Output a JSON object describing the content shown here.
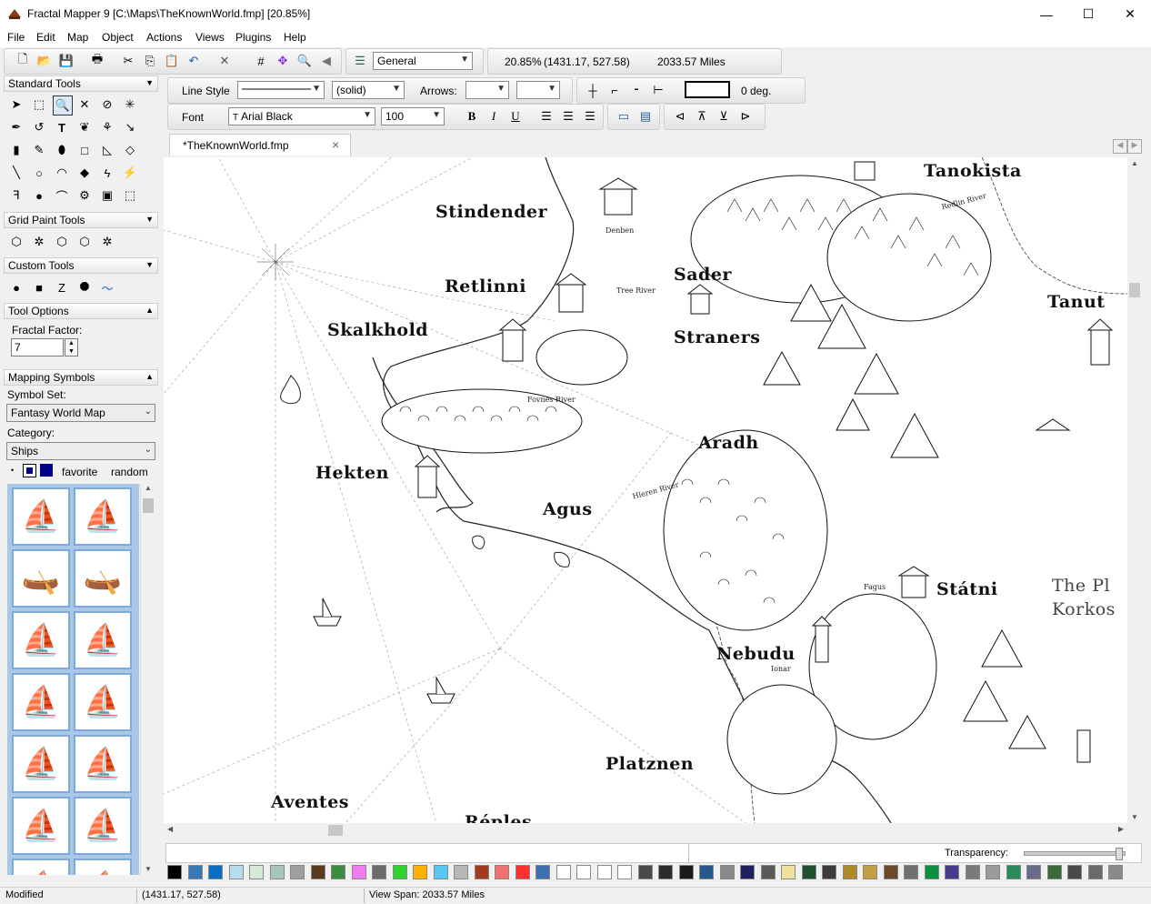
{
  "window": {
    "title": "Fractal Mapper 9 [C:\\Maps\\TheKnownWorld.fmp] [20.85%]",
    "minimize_glyph": "—",
    "maximize_glyph": "☐",
    "close_glyph": "✕"
  },
  "menu": [
    "File",
    "Edit",
    "Map",
    "Object",
    "Actions",
    "Views",
    "Plugins",
    "Help"
  ],
  "main_toolbar": {
    "layer": "General",
    "zoom": "20.85%",
    "coords": "(1431.17, 527.58)",
    "span": "2033.57 Miles"
  },
  "line_toolbar": {
    "line_style_label": "Line Style",
    "line_style_value": "(solid)",
    "arrows_label": "Arrows:",
    "angle": "0 deg."
  },
  "font_toolbar": {
    "font_label": "Font",
    "font_value": "Arial Black",
    "size_value": "100",
    "bold": "B",
    "italic": "I",
    "underline": "U"
  },
  "tab": {
    "label": "*TheKnownWorld.fmp",
    "close": "×"
  },
  "panels": {
    "standard_tools": "Standard Tools",
    "grid_paint_tools": "Grid Paint Tools",
    "custom_tools": "Custom Tools",
    "tool_options": "Tool Options",
    "fractal_factor_label": "Fractal Factor:",
    "fractal_factor_value": "7",
    "mapping_symbols": "Mapping Symbols",
    "symbol_set_label": "Symbol Set:",
    "symbol_set_value": "Fantasy World Map",
    "category_label": "Category:",
    "category_value": "Ships",
    "favorite_label": "favorite",
    "random_label": "random"
  },
  "map_labels": [
    {
      "name": "tanokista",
      "text": "Tanokista"
    },
    {
      "name": "stindender",
      "text": "Stindender"
    },
    {
      "name": "sader",
      "text": "Sader"
    },
    {
      "name": "tanut",
      "text": "Tanut"
    },
    {
      "name": "retlinni",
      "text": "Retlinni"
    },
    {
      "name": "skalkhold",
      "text": "Skalkhold"
    },
    {
      "name": "straners",
      "text": "Straners"
    },
    {
      "name": "aradh",
      "text": "Aradh"
    },
    {
      "name": "hekten",
      "text": "Hekten"
    },
    {
      "name": "agus",
      "text": "Agus"
    },
    {
      "name": "statni",
      "text": "Státni"
    },
    {
      "name": "the-pl",
      "text": "The Pl"
    },
    {
      "name": "korkos",
      "text": "Korkos"
    },
    {
      "name": "nebudu",
      "text": "Nebudu"
    },
    {
      "name": "platznen",
      "text": "Platznen"
    },
    {
      "name": "aventes",
      "text": "Aventes"
    },
    {
      "name": "reples",
      "text": "Réples"
    }
  ],
  "map_small_labels": [
    {
      "name": "denben",
      "text": "Denben"
    },
    {
      "name": "tree-river",
      "text": "Tree River"
    },
    {
      "name": "fovnes-river",
      "text": "Fovnes River"
    },
    {
      "name": "hleren-river",
      "text": "Hleren River"
    },
    {
      "name": "fagus",
      "text": "Fagus"
    },
    {
      "name": "ionar",
      "text": "Ionar"
    },
    {
      "name": "redlin-river",
      "text": "Redlin River"
    }
  ],
  "bottom": {
    "transparency_label": "Transparency:",
    "palette": [
      "#000000",
      "#3a78b5",
      "#0a6fc2",
      "#b7dcf0",
      "#d6ead7",
      "#a9c7b9",
      "#9e9e9e",
      "#5b3b1e",
      "#3d8c3d",
      "#f07cf0",
      "#6b6b6b",
      "#2fd12f",
      "#ffb000",
      "#57c7f0",
      "#b7b7b7",
      "#a33a1c",
      "#f07070",
      "#ff3030",
      "#3e6fb0",
      "#ffffff",
      "#ffffff",
      "#ffffff",
      "#ffffff",
      "#4a4a4a",
      "#2b2b2b",
      "#1a1a1a",
      "#26588a",
      "#8a8a8a",
      "#202060",
      "#5a5a5a",
      "#f0e0a0",
      "#205030",
      "#3b3b3b",
      "#b08a2a",
      "#c0a040",
      "#6a4a2a",
      "#6f6f6f",
      "#0a9040",
      "#4a3a8a",
      "#7a7a7a",
      "#9a9a9a",
      "#2a8a5a",
      "#6a6a8a",
      "#3a6a3a",
      "#4a4a4a",
      "#6a6a6a",
      "#8a8a8a"
    ]
  },
  "status": {
    "state": "Modified",
    "coords": "(1431.17, 527.58)",
    "view_span": "View Span: 2033.57 Miles"
  }
}
